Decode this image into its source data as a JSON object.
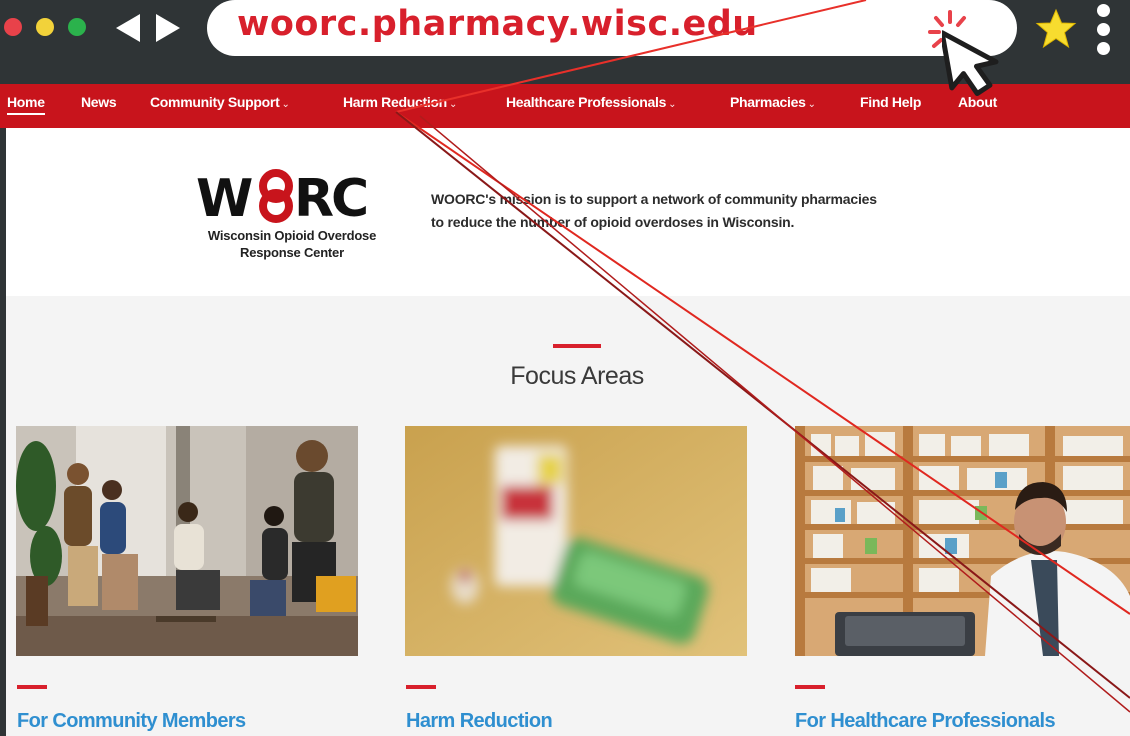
{
  "browser": {
    "url": "woorc.pharmacy.wisc.edu",
    "icons": [
      "close-dot",
      "minimize-dot",
      "maximize-dot",
      "back-arrow-icon",
      "forward-arrow-icon",
      "sparkle-icon",
      "cursor-icon",
      "star-icon",
      "kebab-menu-icon"
    ]
  },
  "nav": {
    "items": [
      {
        "label": "Home",
        "dropdown": false,
        "active": true
      },
      {
        "label": "News",
        "dropdown": false
      },
      {
        "label": "Community Support",
        "dropdown": true
      },
      {
        "label": "Harm Reduction",
        "dropdown": true
      },
      {
        "label": "Healthcare Professionals",
        "dropdown": true
      },
      {
        "label": "Pharmacies",
        "dropdown": true
      },
      {
        "label": "Find Help",
        "dropdown": false
      },
      {
        "label": "About",
        "dropdown": false
      }
    ],
    "caret": "⌄"
  },
  "hero": {
    "logo_text": "WORC",
    "logo_subtitle_line1": "Wisconsin Opioid Overdose",
    "logo_subtitle_line2": "Response Center",
    "mission_line1": "WOORC's mission is to support a network of community pharmacies",
    "mission_line2": "to reduce the number of opioid overdoses in Wisconsin."
  },
  "focus": {
    "title": "Focus Areas",
    "cards": [
      {
        "title": "For Community Members",
        "image": "support-group-photo"
      },
      {
        "title": "Harm Reduction",
        "image": "naloxone-box-photo"
      },
      {
        "title": "For Healthcare Professionals",
        "image": "pharmacist-photo"
      }
    ]
  },
  "colors": {
    "brand_red": "#c8141c",
    "accent_red": "#d8202c",
    "chrome_dark": "#2f3436",
    "link_blue": "#2f8fd0",
    "focus_bg": "#f4f4f4"
  }
}
